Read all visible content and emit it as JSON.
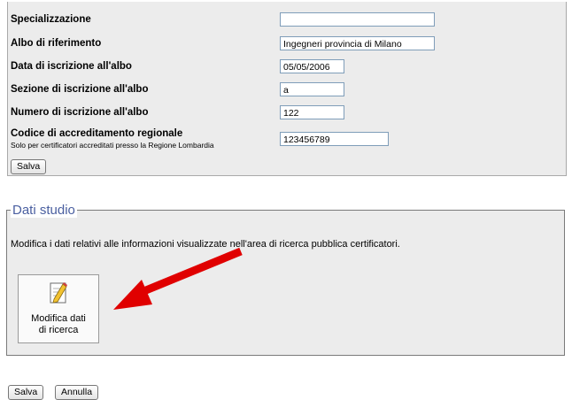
{
  "form": {
    "rows": [
      {
        "label": "Specializzazione",
        "value": ""
      },
      {
        "label": "Albo di riferimento",
        "value": "Ingegneri provincia di Milano"
      },
      {
        "label": "Data di iscrizione all'albo",
        "value": "05/05/2006"
      },
      {
        "label": "Sezione di iscrizione all'albo",
        "value": "a"
      },
      {
        "label": "Numero di iscrizione all'albo",
        "value": "122"
      },
      {
        "label": "Codice di accreditamento regionale",
        "value": "123456789"
      }
    ],
    "codice_note": "Solo per certificatori accreditati presso la Regione Lombardia",
    "save_label": "Salva"
  },
  "dati_studio": {
    "legend": "Dati studio",
    "description": "Modifica i dati relativi alle informazioni visualizzate nell'area di ricerca pubblica certificatori.",
    "tile_label_line1": "Modifica dati",
    "tile_label_line2": "di ricerca",
    "arrow_color": "#e00000"
  },
  "footer": {
    "save_label": "Salva",
    "cancel_label": "Annulla"
  }
}
